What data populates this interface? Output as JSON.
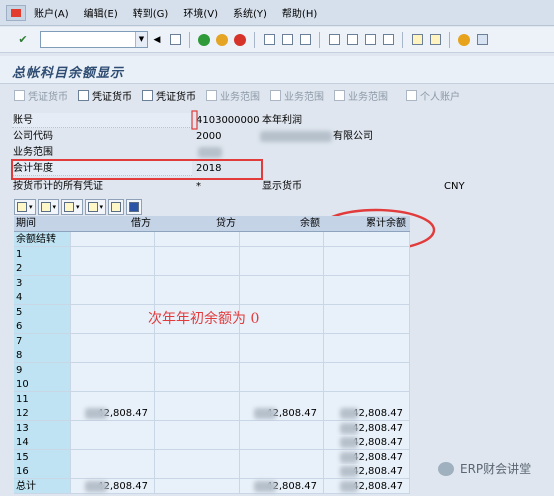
{
  "menu": {
    "items": [
      "账户(A)",
      "编辑(E)",
      "转到(G)",
      "环境(V)",
      "系统(Y)",
      "帮助(H)"
    ]
  },
  "toolbar": {
    "command_value": ""
  },
  "title": "总帐科目余额显示",
  "app_toolbar": {
    "buttons": [
      {
        "label": "凭证货币",
        "enabled": false
      },
      {
        "label": "凭证货币",
        "enabled": true
      },
      {
        "label": "凭证货币",
        "enabled": true
      },
      {
        "label": "业务范围",
        "enabled": false
      },
      {
        "label": "业务范围",
        "enabled": false
      },
      {
        "label": "业务范围",
        "enabled": false
      },
      {
        "label": "个人账户",
        "enabled": false
      }
    ]
  },
  "header": {
    "account_label": "账号",
    "account_value": "4103000000",
    "account_desc": "本年利润",
    "company_label": "公司代码",
    "company_value": "2000",
    "company_desc_visible": "有限公司",
    "business_area_label": "业务范围",
    "fiscal_year_label": "会计年度",
    "fiscal_year_value": "2018",
    "doc_currency_label": "按货币计的所有凭证",
    "doc_currency_value": "*",
    "display_currency_label": "显示货币",
    "display_currency_value": "CNY"
  },
  "grid": {
    "columns": [
      "期间",
      "借方",
      "贷方",
      "余额",
      "累计余额"
    ],
    "rows": [
      {
        "period": "余额结转",
        "debit": "",
        "credit": "",
        "balance": "",
        "cumulative": ""
      },
      {
        "period": "1",
        "debit": "",
        "credit": "",
        "balance": "",
        "cumulative": ""
      },
      {
        "period": "2",
        "debit": "",
        "credit": "",
        "balance": "",
        "cumulative": ""
      },
      {
        "period": "3",
        "debit": "",
        "credit": "",
        "balance": "",
        "cumulative": ""
      },
      {
        "period": "4",
        "debit": "",
        "credit": "",
        "balance": "",
        "cumulative": ""
      },
      {
        "period": "5",
        "debit": "",
        "credit": "",
        "balance": "",
        "cumulative": ""
      },
      {
        "period": "6",
        "debit": "",
        "credit": "",
        "balance": "",
        "cumulative": ""
      },
      {
        "period": "7",
        "debit": "",
        "credit": "",
        "balance": "",
        "cumulative": ""
      },
      {
        "period": "8",
        "debit": "",
        "credit": "",
        "balance": "",
        "cumulative": ""
      },
      {
        "period": "9",
        "debit": "",
        "credit": "",
        "balance": "",
        "cumulative": ""
      },
      {
        "period": "10",
        "debit": "",
        "credit": "",
        "balance": "",
        "cumulative": ""
      },
      {
        "period": "11",
        "debit": "",
        "credit": "",
        "balance": "",
        "cumulative": ""
      },
      {
        "period": "12",
        "debit": "42,808.47",
        "credit": "",
        "balance": "42,808.47",
        "cumulative": "42,808.47"
      },
      {
        "period": "13",
        "debit": "",
        "credit": "",
        "balance": "",
        "cumulative": "42,808.47"
      },
      {
        "period": "14",
        "debit": "",
        "credit": "",
        "balance": "",
        "cumulative": "42,808.47"
      },
      {
        "period": "15",
        "debit": "",
        "credit": "",
        "balance": "",
        "cumulative": "42,808.47"
      },
      {
        "period": "16",
        "debit": "",
        "credit": "",
        "balance": "",
        "cumulative": "42,808.47"
      },
      {
        "period": "总计",
        "debit": "42,808.47",
        "credit": "",
        "balance": "42,808.47",
        "cumulative": "42,808.47"
      }
    ]
  },
  "annotation": "次年年初余额为 0",
  "watermark": "ERP财会讲堂",
  "colors": {
    "annotation_red": "#e23b3b",
    "key_column": "#bfe3f2",
    "grid_cell": "#e8f0f9"
  }
}
